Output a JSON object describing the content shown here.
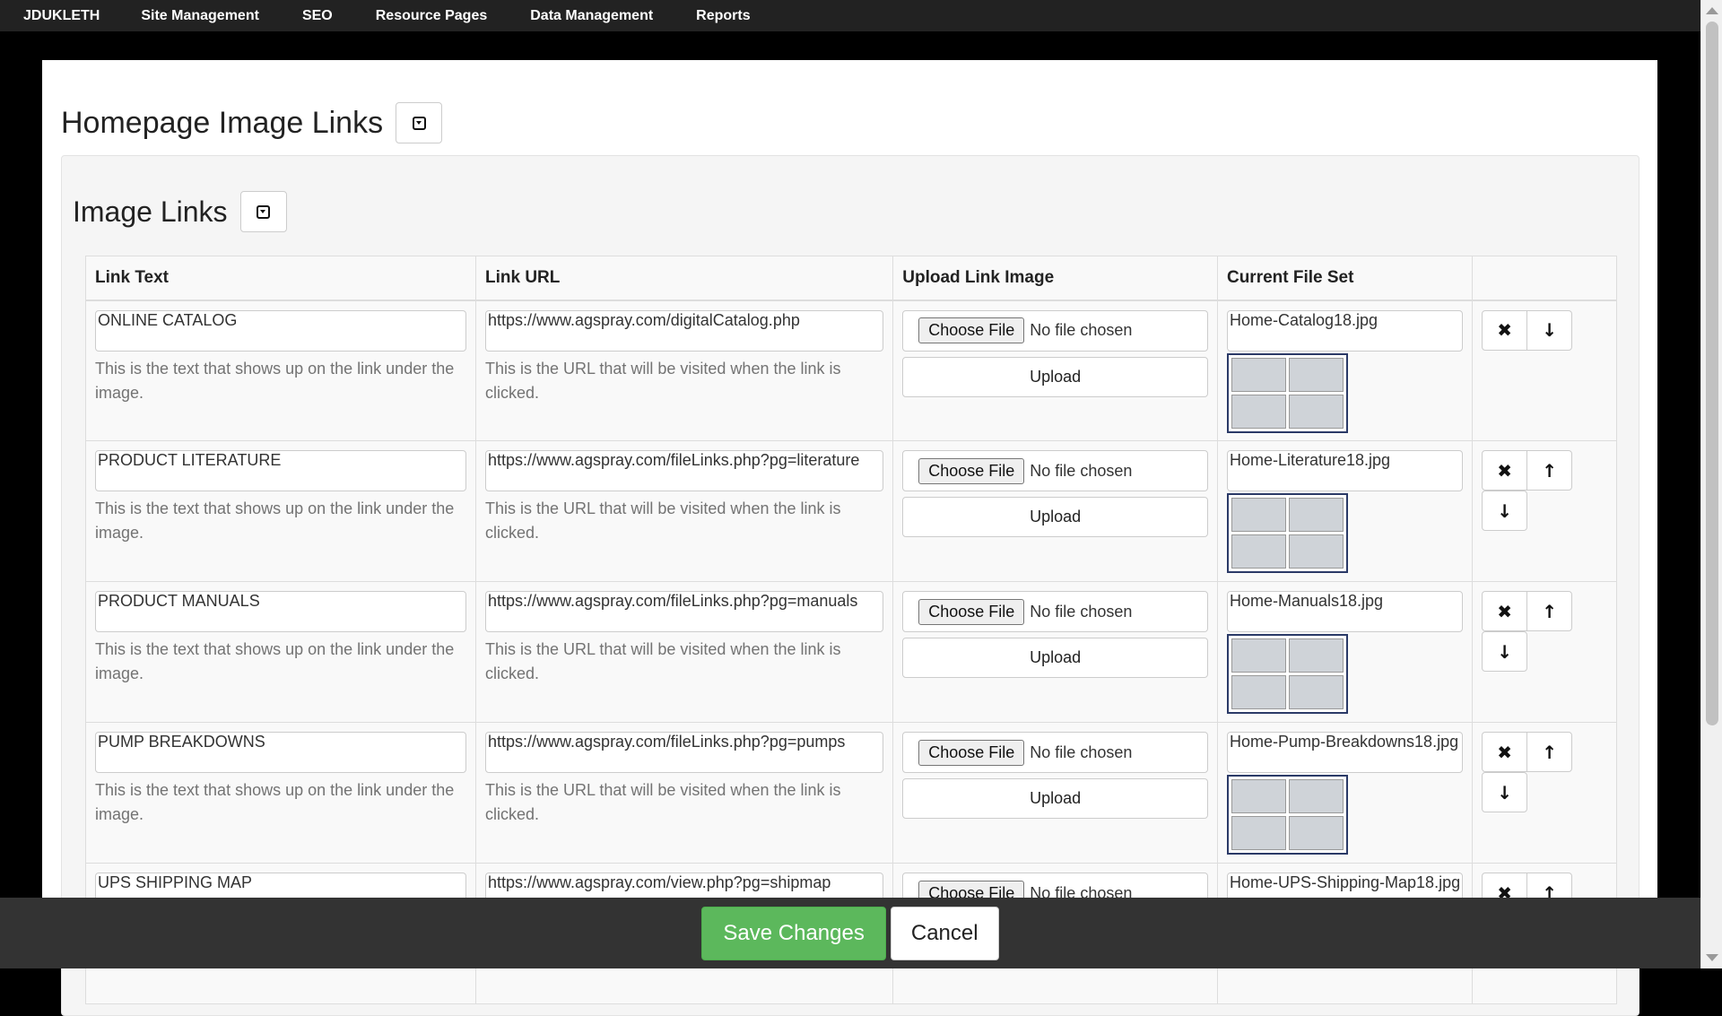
{
  "nav": {
    "brand": "JDUKLETH",
    "items": [
      "Site Management",
      "SEO",
      "Resource Pages",
      "Data Management",
      "Reports"
    ]
  },
  "page": {
    "title": "Homepage Image Links",
    "section_title": "Image Links"
  },
  "table": {
    "headers": [
      "Link Text",
      "Link URL",
      "Upload Link Image",
      "Current File Set"
    ],
    "link_text_help": "This is the text that shows up on the link under the image.",
    "link_url_help": "This is the URL that will be visited when the link is clicked.",
    "choose_file_label": "Choose File",
    "no_file_label": "No file chosen",
    "upload_label": "Upload",
    "rows": [
      {
        "text": "ONLINE CATALOG",
        "url": "https://www.agspray.com/digitalCatalog.php",
        "file": "Home-Catalog18.jpg"
      },
      {
        "text": "PRODUCT LITERATURE",
        "url": "https://www.agspray.com/fileLinks.php?pg=literature",
        "file": "Home-Literature18.jpg"
      },
      {
        "text": "PRODUCT MANUALS",
        "url": "https://www.agspray.com/fileLinks.php?pg=manuals",
        "file": "Home-Manuals18.jpg"
      },
      {
        "text": "PUMP BREAKDOWNS",
        "url": "https://www.agspray.com/fileLinks.php?pg=pumps",
        "file": "Home-Pump-Breakdowns18.jpg"
      },
      {
        "text": "UPS SHIPPING MAP",
        "url": "https://www.agspray.com/view.php?pg=shipmap",
        "file": "Home-UPS-Shipping-Map18.jpg"
      }
    ]
  },
  "footer": {
    "save_label": "Save Changes",
    "cancel_label": "Cancel"
  },
  "colors": {
    "nav_bg": "#222222",
    "save_green": "#5cb85c",
    "footer_bg": "#333333"
  }
}
